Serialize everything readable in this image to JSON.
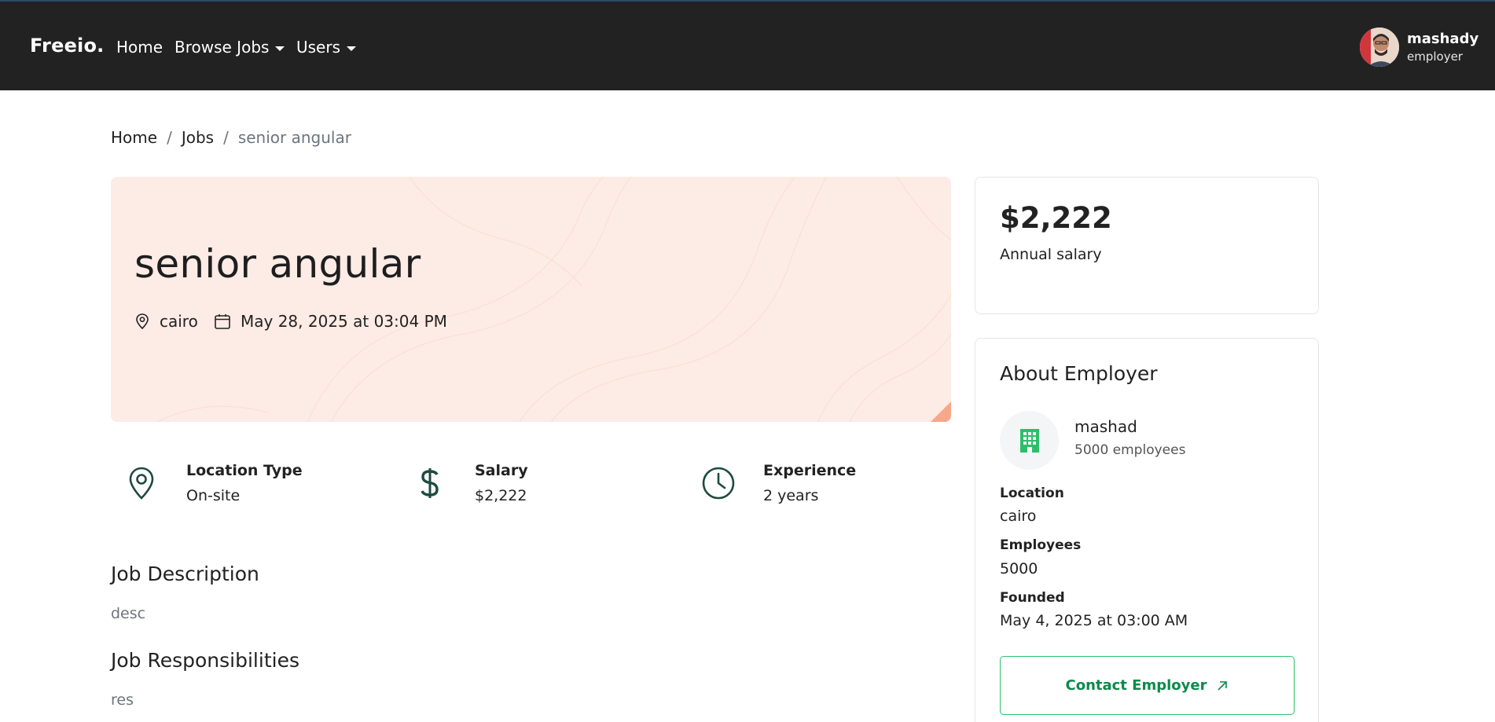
{
  "navbar": {
    "brand": "Freeio.",
    "links": [
      {
        "label": "Home"
      },
      {
        "label": "Browse Jobs"
      },
      {
        "label": "Users"
      }
    ],
    "user": {
      "name": "mashady",
      "role": "employer"
    }
  },
  "breadcrumb": {
    "items": [
      "Home",
      "Jobs"
    ],
    "separator": "/",
    "current": "senior angular"
  },
  "job": {
    "title": "senior angular",
    "location": "cairo",
    "posted": "May 28, 2025 at 03:04 PM",
    "features": [
      {
        "icon": "map-pin-icon",
        "title": "Location Type",
        "value": "On-site"
      },
      {
        "icon": "dollar-icon",
        "title": "Salary",
        "value": "$2,222"
      },
      {
        "icon": "clock-icon",
        "title": "Experience",
        "value": "2 years"
      }
    ],
    "description_heading": "Job Description",
    "description": "desc",
    "responsibilities_heading": "Job Responsibilities",
    "responsibilities": "res"
  },
  "salary_card": {
    "amount": "$2,222",
    "label": "Annual salary"
  },
  "employer_card": {
    "title": "About Employer",
    "name": "mashad",
    "size": "5000 employees",
    "details": [
      {
        "label": "Location",
        "value": "cairo"
      },
      {
        "label": "Employees",
        "value": "5000"
      },
      {
        "label": "Founded",
        "value": "May 4, 2025 at 03:00 AM"
      }
    ],
    "contact_label": "Contact Employer"
  },
  "colors": {
    "navbar_bg": "#222222",
    "hero_bg": "#fdebe5",
    "accent_green": "#0b8a4a",
    "icon_dark_green": "#1f4a3f",
    "muted_text": "#6c757d"
  }
}
